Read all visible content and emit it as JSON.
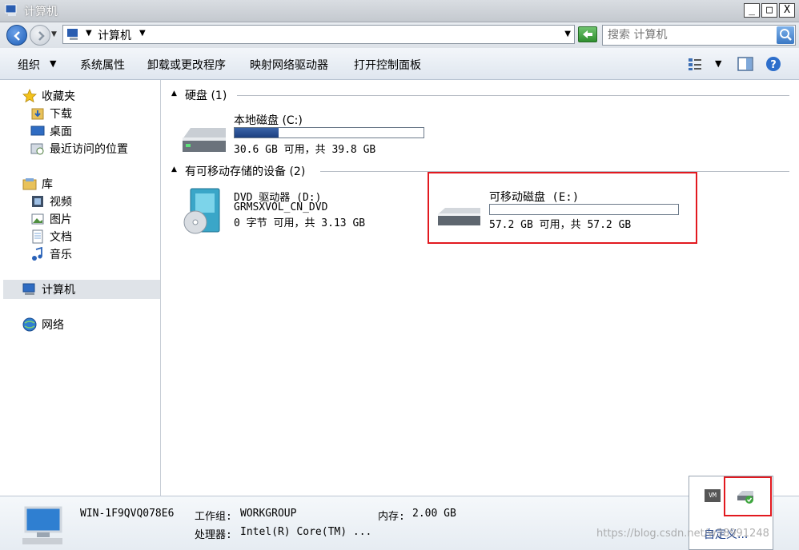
{
  "window": {
    "title": "计算机",
    "minimize": "_",
    "maximize": "□",
    "close": "X"
  },
  "address": {
    "path": "计算机",
    "search_placeholder": "搜索 计算机"
  },
  "toolbar": {
    "organize": "组织",
    "system_properties": "系统属性",
    "uninstall": "卸载或更改程序",
    "map_drive": "映射网络驱动器",
    "control_panel": "打开控制面板"
  },
  "nav": {
    "favorites": "收藏夹",
    "downloads": "下载",
    "desktop": "桌面",
    "recent": "最近访问的位置",
    "libraries": "库",
    "videos": "视频",
    "pictures": "图片",
    "documents": "文档",
    "music": "音乐",
    "computer": "计算机",
    "network": "网络"
  },
  "groups": {
    "hard_disks": "硬盘 (1)",
    "removable": "有可移动存储的设备 (2)"
  },
  "drives": {
    "c": {
      "name": "本地磁盘 (C:)",
      "info": "30.6 GB 可用，共 39.8 GB",
      "used_fraction": 0.231
    },
    "d": {
      "name": "DVD 驱动器 (D:)",
      "label": "GRMSXVOL_CN_DVD",
      "info": "0 字节 可用，共 3.13 GB"
    },
    "e": {
      "name": "可移动磁盘 (E:)",
      "info": "57.2 GB 可用，共 57.2 GB",
      "used_fraction": 0.0
    }
  },
  "details": {
    "computer_name": "WIN-1F9QVQ078E6",
    "workgroup_label": "工作组:",
    "workgroup": "WORKGROUP",
    "memory_label": "内存:",
    "memory": "2.00 GB",
    "cpu_label": "处理器:",
    "cpu": "Intel(R) Core(TM) ..."
  },
  "tray": {
    "customize": "自定义...",
    "vm_label": "VM"
  },
  "watermark": "https://blog.csdn.net/w38991248"
}
